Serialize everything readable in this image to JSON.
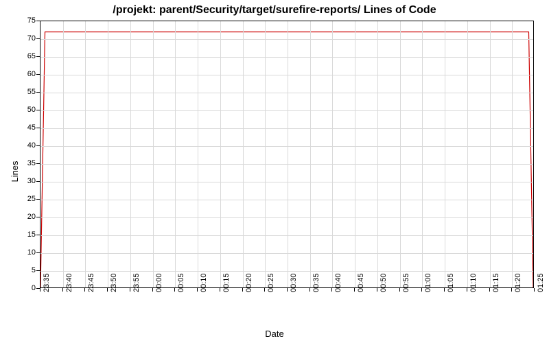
{
  "chart_data": {
    "type": "line",
    "title": "/projekt: parent/Security/target/surefire-reports/ Lines of Code",
    "xlabel": "Date",
    "ylabel": "Lines",
    "ylim": [
      0,
      75
    ],
    "y_ticks": [
      0,
      5,
      10,
      15,
      20,
      25,
      30,
      35,
      40,
      45,
      50,
      55,
      60,
      65,
      70,
      75
    ],
    "x_categories": [
      "23:35",
      "23:40",
      "23:45",
      "23:50",
      "23:55",
      "00:00",
      "00:05",
      "00:10",
      "00:15",
      "00:20",
      "00:25",
      "00:30",
      "00:35",
      "00:40",
      "00:45",
      "00:50",
      "00:55",
      "01:00",
      "01:05",
      "01:10",
      "01:15",
      "01:20",
      "01:25"
    ],
    "series": [
      {
        "name": "Lines of Code",
        "color": "#cc0000",
        "x": [
          "23:35",
          "23:36",
          "01:24",
          "01:25"
        ],
        "y": [
          0,
          72,
          72,
          0
        ]
      }
    ],
    "grid": true
  }
}
